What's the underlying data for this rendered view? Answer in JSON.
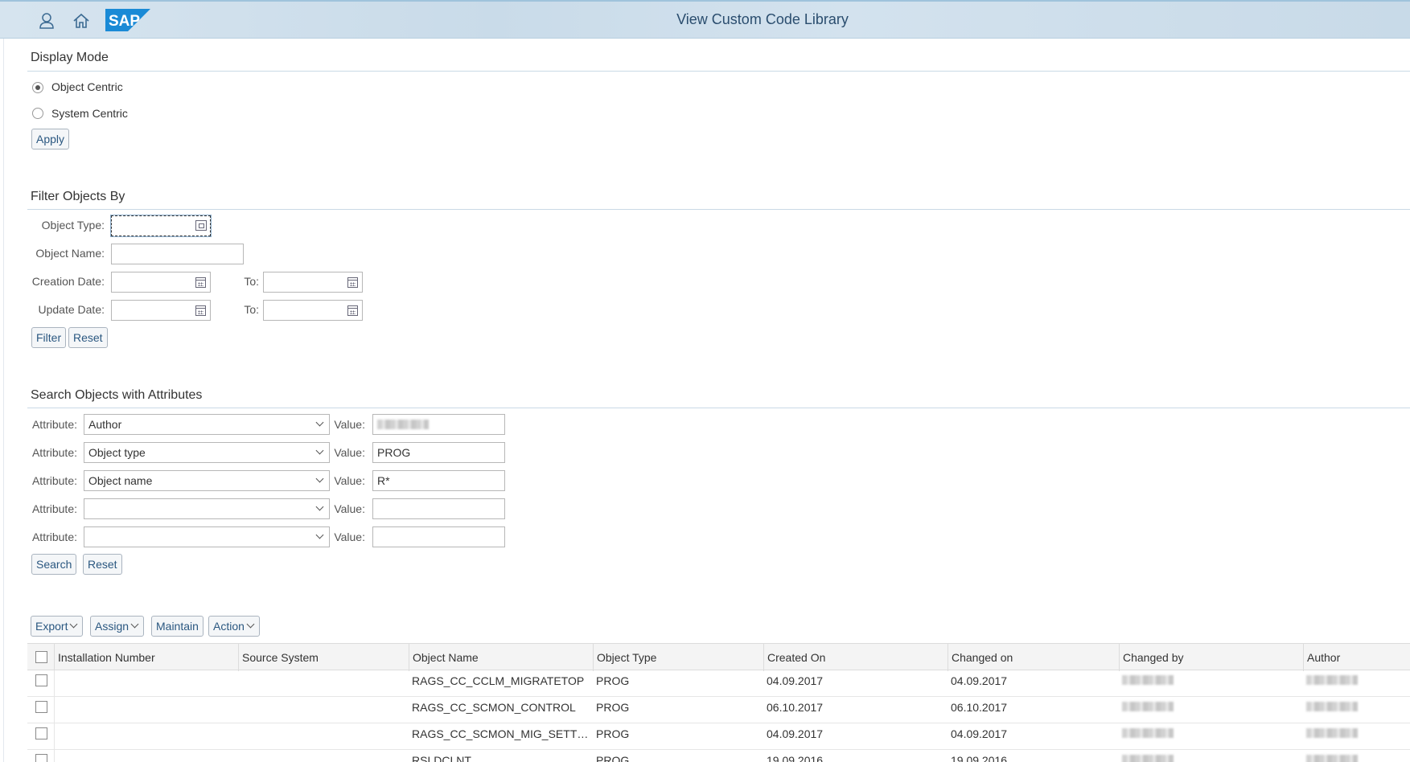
{
  "shell": {
    "title": "View Custom Code Library"
  },
  "display_mode": {
    "title": "Display Mode",
    "options": [
      {
        "label": "Object Centric",
        "selected": true
      },
      {
        "label": "System Centric",
        "selected": false
      }
    ],
    "apply_label": "Apply"
  },
  "filter": {
    "title": "Filter Objects By",
    "object_type_label": "Object Type:",
    "object_name_label": "Object Name:",
    "creation_date_label": "Creation Date:",
    "update_date_label": "Update Date:",
    "to_label": "To:",
    "object_type_value": "",
    "object_name_value": "",
    "filter_label": "Filter",
    "reset_label": "Reset"
  },
  "search": {
    "title": "Search Objects with Attributes",
    "attribute_label": "Attribute:",
    "value_label": "Value:",
    "rows": [
      {
        "attribute": "Author",
        "value": ""
      },
      {
        "attribute": "Object type",
        "value": "PROG"
      },
      {
        "attribute": "Object name",
        "value": "R*"
      },
      {
        "attribute": "",
        "value": ""
      },
      {
        "attribute": "",
        "value": ""
      }
    ],
    "search_label": "Search",
    "reset_label": "Reset"
  },
  "toolbar": {
    "export_label": "Export",
    "assign_label": "Assign",
    "maintain_label": "Maintain",
    "action_label": "Action"
  },
  "table": {
    "columns": [
      "Installation Number",
      "Source System",
      "Object Name",
      "Object Type",
      "Created On",
      "Changed on",
      "Changed by",
      "Author"
    ],
    "rows": [
      {
        "installation_number": "",
        "source_system": "",
        "object_name": "RAGS_CC_CCLM_MIGRATETOP",
        "object_type": "PROG",
        "created_on": "04.09.2017",
        "changed_on": "04.09.2017"
      },
      {
        "installation_number": "",
        "source_system": "",
        "object_name": "RAGS_CC_SCMON_CONTROL",
        "object_type": "PROG",
        "created_on": "06.10.2017",
        "changed_on": "06.10.2017"
      },
      {
        "installation_number": "",
        "source_system": "",
        "object_name": "RAGS_CC_SCMON_MIG_SETT…",
        "object_type": "PROG",
        "created_on": "04.09.2017",
        "changed_on": "04.09.2017"
      },
      {
        "installation_number": "",
        "source_system": "",
        "object_name": "RSLDCLNT",
        "object_type": "PROG",
        "created_on": "19.09.2016",
        "changed_on": "19.09.2016"
      }
    ]
  }
}
